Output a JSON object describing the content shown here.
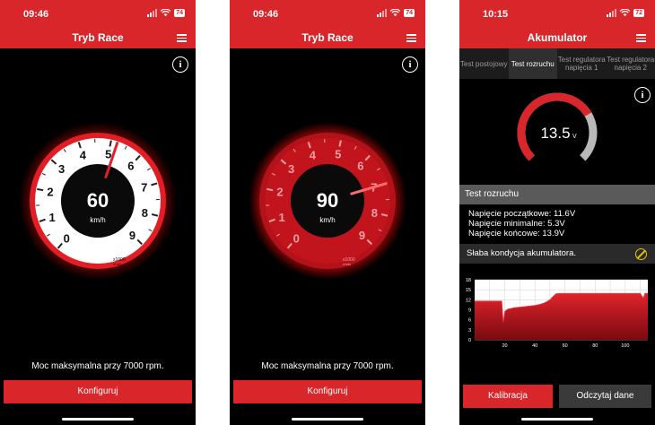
{
  "screens": [
    {
      "status": {
        "time": "09:46",
        "battery": "74"
      },
      "header": {
        "title": "Tryb Race"
      },
      "gauge": {
        "variant": "white",
        "speed": "60",
        "unit": "km/h",
        "ticks": [
          "0",
          "1",
          "2",
          "3",
          "4",
          "5",
          "6",
          "7",
          "8",
          "9"
        ],
        "rpm_x1000": 5.2,
        "rpm_label_top": "x1000",
        "rpm_label_bottom": "r/min"
      },
      "power_text": "Moc maksymalna przy 7000 rpm.",
      "configure_label": "Konfiguruj"
    },
    {
      "status": {
        "time": "09:46",
        "battery": "74"
      },
      "header": {
        "title": "Tryb Race"
      },
      "gauge": {
        "variant": "red",
        "speed": "90",
        "unit": "km/h",
        "ticks": [
          "0",
          "1",
          "2",
          "3",
          "4",
          "5",
          "6",
          "7",
          "8",
          "9"
        ],
        "rpm_x1000": 7.0,
        "rpm_label_top": "x1000",
        "rpm_label_bottom": "r/min"
      },
      "power_text": "Moc maksymalna przy 7000 rpm.",
      "configure_label": "Konfiguruj"
    },
    {
      "status": {
        "time": "10:15",
        "battery": "72"
      },
      "header": {
        "title": "Akumulator"
      },
      "tabs": [
        {
          "label": "Test postojowy",
          "active": false
        },
        {
          "label": "Test rozruchu",
          "active": true
        },
        {
          "label": "Test regulatora napięcia 1",
          "active": false
        },
        {
          "label": "Test regulatora napięcia 2",
          "active": false
        }
      ],
      "voltage_gauge": {
        "value": "13.5",
        "unit": "V",
        "fill_fraction": 0.72
      },
      "section_title": "Test rozruchu",
      "readings": [
        "Napięcie początkowe: 11.6V",
        "Napięcie minimalne: 5.3V",
        "Napięcie końcowe: 13.9V"
      ],
      "warning": "Słaba kondycja akumulatora.",
      "chart_data": {
        "type": "area",
        "ylim": [
          0,
          18
        ],
        "yticks": [
          "0",
          "3",
          "6",
          "9",
          "12",
          "15",
          "18"
        ],
        "xlim": [
          0,
          115
        ],
        "xticks": [
          "20",
          "40",
          "60",
          "80",
          "100"
        ],
        "x": [
          0,
          18,
          19,
          20,
          22,
          24,
          26,
          28,
          30,
          32,
          34,
          36,
          38,
          40,
          42,
          44,
          46,
          48,
          50,
          52,
          54,
          56,
          58,
          60,
          70,
          80,
          90,
          100,
          110,
          112,
          113,
          115
        ],
        "values": [
          11.6,
          11.6,
          5.3,
          8.5,
          9.2,
          9.4,
          9.6,
          9.7,
          9.8,
          9.9,
          10.0,
          10.1,
          10.2,
          10.3,
          10.5,
          10.7,
          11.0,
          11.5,
          12.0,
          13.0,
          13.8,
          13.9,
          13.9,
          13.9,
          13.9,
          13.9,
          13.9,
          13.9,
          13.9,
          12.5,
          13.9,
          13.9
        ]
      },
      "buttons": {
        "calibrate": "Kalibracja",
        "read": "Odczytaj dane"
      }
    }
  ]
}
